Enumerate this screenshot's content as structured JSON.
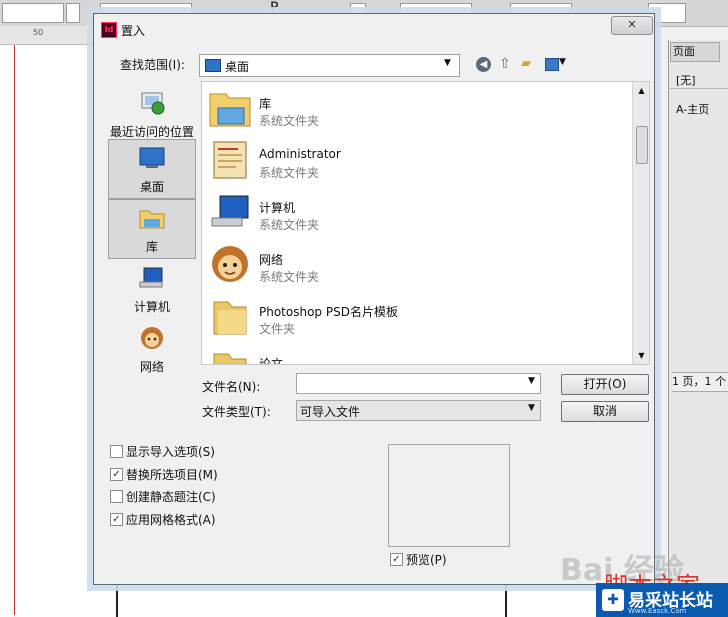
{
  "dialog": {
    "title": "置入",
    "app_icon_text": "Id",
    "close_label": "✕",
    "look_in_label": "查找范围(I):",
    "look_in_value": "桌面",
    "toolbar_icons": [
      "back-icon",
      "up-folder-icon",
      "new-folder-icon",
      "views-menu-icon"
    ]
  },
  "places": [
    {
      "label": "最近访问的位置",
      "icon": "recent-places-icon",
      "selected": false
    },
    {
      "label": "桌面",
      "icon": "desktop-icon",
      "selected": true
    },
    {
      "label": "库",
      "icon": "libraries-icon",
      "selected": true
    },
    {
      "label": "计算机",
      "icon": "computer-icon",
      "selected": false
    },
    {
      "label": "网络",
      "icon": "network-icon",
      "selected": false
    }
  ],
  "files": [
    {
      "name": "库",
      "type": "系统文件夹",
      "icon": "libraries-icon"
    },
    {
      "name": "Administrator",
      "type": "系统文件夹",
      "icon": "user-folder-icon"
    },
    {
      "name": "计算机",
      "type": "系统文件夹",
      "icon": "computer-icon"
    },
    {
      "name": "网络",
      "type": "系统文件夹",
      "icon": "network-icon"
    },
    {
      "name": "Photoshop PSD名片模板",
      "type": "文件夹",
      "icon": "folder-icon"
    },
    {
      "name": "论文",
      "type": "",
      "icon": "folder-icon"
    }
  ],
  "file_name": {
    "label": "文件名(N):",
    "value": ""
  },
  "file_type": {
    "label": "文件类型(T):",
    "value": "可导入文件"
  },
  "buttons": {
    "open": "打开(O)",
    "cancel": "取消"
  },
  "options": [
    {
      "label": "显示导入选项(S)",
      "checked": false
    },
    {
      "label": "替换所选项目(M)",
      "checked": true
    },
    {
      "label": "创建静态题注(C)",
      "checked": false
    },
    {
      "label": "应用网格格式(A)",
      "checked": true
    }
  ],
  "preview": {
    "label": "预览(P)",
    "checked": true
  },
  "pages_panel": {
    "tab": "页面",
    "none_item": "[无]",
    "master_item": "A-主页",
    "status": "1 页，1 个"
  },
  "ruler_number": "50",
  "watermark": {
    "overlay": "Bai 经验",
    "red_text": "脚本之家",
    "badge_text": "易采站长站",
    "badge_sub": "Www.Easck.Com"
  },
  "colors": {
    "accent": "#2d74c9",
    "dialog_border": "#5a6775",
    "watermark_badge": "#0a5bb0",
    "watermark_red": "#d9352c"
  }
}
